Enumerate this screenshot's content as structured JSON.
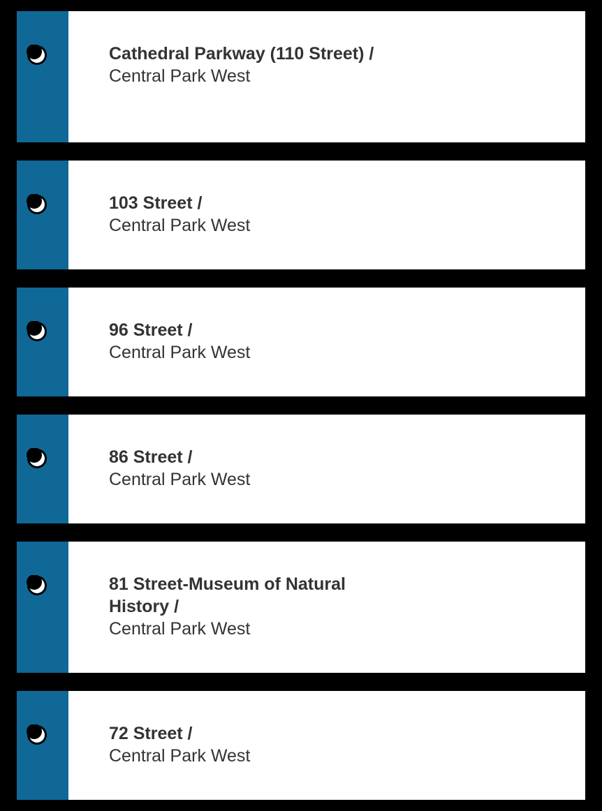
{
  "colors": {
    "background": "#000000",
    "card": "#ffffff",
    "accent_bar": "#106897",
    "text": "#333333"
  },
  "stations": [
    {
      "name": "Cathedral Parkway (110 Street) /",
      "street": "Central Park West",
      "icon": "night-moon-icon"
    },
    {
      "name": "103 Street /",
      "street": "Central Park West",
      "icon": "night-moon-icon"
    },
    {
      "name": "96 Street /",
      "street": "Central Park West",
      "icon": "night-moon-icon"
    },
    {
      "name": "86 Street /",
      "street": "Central Park West",
      "icon": "night-moon-icon"
    },
    {
      "name": "81 Street-Museum of Natural History /",
      "street": "Central Park West",
      "icon": "night-moon-icon"
    },
    {
      "name": "72 Street /",
      "street": "Central Park West",
      "icon": "night-moon-icon"
    }
  ]
}
